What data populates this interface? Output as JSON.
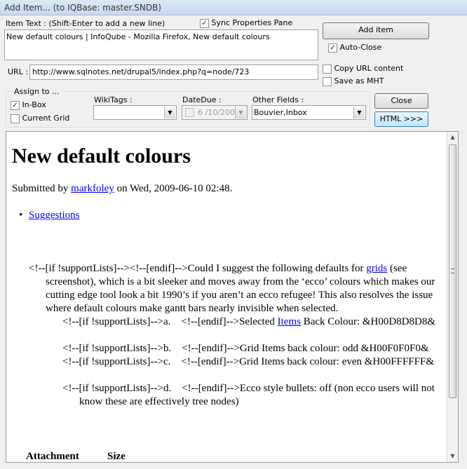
{
  "window": {
    "title": "Add Item... (to IQBase: master.SNDB)"
  },
  "item_text": {
    "label": "Item Text : (Shift-Enter to add a new line)",
    "value": "New default colours | InfoQube - Mozilla Firefox, New default colours"
  },
  "sync": {
    "label": "Sync Properties Pane",
    "checked": true
  },
  "add_item_label": "Add item",
  "auto_close": {
    "label": "Auto-Close",
    "checked": true
  },
  "url": {
    "label": "URL :",
    "value": "http://www.sqlnotes.net/drupal5/index.php?q=node/723"
  },
  "copy_url": {
    "label": "Copy URL content",
    "checked": false
  },
  "save_mht": {
    "label": "Save as MHT",
    "checked": false
  },
  "assign": {
    "title": "Assign to ...",
    "inbox": {
      "label": "In-Box",
      "checked": true
    },
    "current_grid": {
      "label": "Current Grid",
      "checked": false
    }
  },
  "wikitags": {
    "label": "WikiTags :",
    "value": ""
  },
  "datedue": {
    "label": "DateDue :",
    "value": "6 /10/200"
  },
  "other_fields": {
    "label": "Other Fields :",
    "value": "Bouvier,Inbox"
  },
  "close_label": "Close",
  "html_label": "HTML >>>",
  "page": {
    "heading": "New default colours",
    "submitted_prefix": "Submitted by ",
    "author": "markfoley",
    "submitted_suffix": " on Wed, 2009-06-10 02:48.",
    "bullet_link": "Suggestions",
    "para_a": "<!--[if !supportLists]--><!--[endif]-->Could I suggest the following defaults for ",
    "para_link": "grids",
    "para_b": " (see screenshot), which is a bit sleeker and moves away from the ‘ecco’ colours which makes our cutting edge tool look a bit 1990’s if you aren’t an ecco refugee!  This also resolves the issue where default colours make gantt bars nearly invisible when selected.",
    "item_a_pre": "<!--[if !supportLists]-->a.    <!--[endif]-->Selected ",
    "item_a_link": "Items",
    "item_a_post": " Back Colour: &H00D8D8D8&",
    "item_b": "<!--[if !supportLists]-->b.    <!--[endif]-->Grid Items back colour: odd &H00F0F0F0&",
    "item_c": "<!--[if !supportLists]-->c.    <!--[endif]-->Grid Items back colour: even &H00FFFFFF&",
    "item_d": "<!--[if !supportLists]-->d.    <!--[endif]-->Ecco style bullets: off (non ecco users will not know these are effectively tree nodes)",
    "col_attachment": "Attachment",
    "col_size": "Size"
  },
  "colors": {
    "link": "#0000ee",
    "titlebar": "#c7d9ee"
  }
}
